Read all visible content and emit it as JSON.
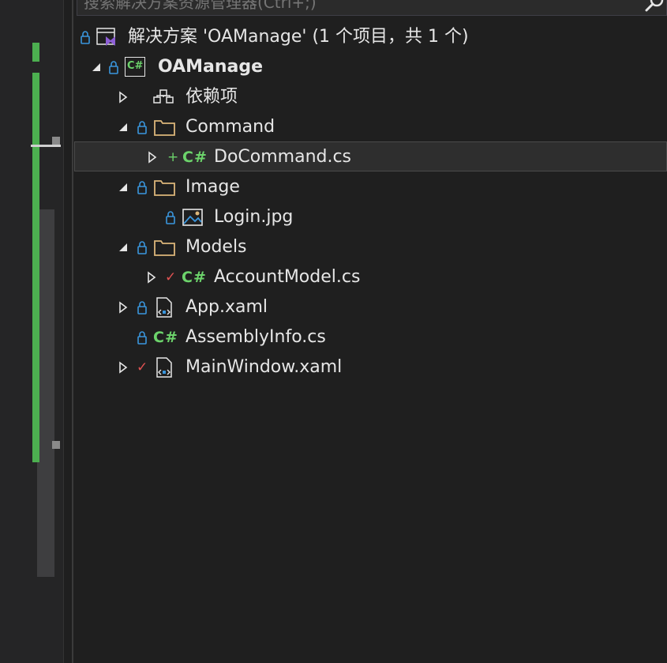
{
  "search": {
    "placeholder": "搜索解决方案资源管理器(Ctrl+;)"
  },
  "solution": {
    "label": "解决方案 'OAManage' (1 个项目，共 1 个)"
  },
  "project": {
    "label": "OAManage"
  },
  "tree": {
    "dependencies": "依赖项",
    "command": "Command",
    "docommand": "DoCommand.cs",
    "image": "Image",
    "login": "Login.jpg",
    "models": "Models",
    "accountmodel": "AccountModel.cs",
    "app": "App.xaml",
    "assemblyinfo": "AssemblyInfo.cs",
    "mainwindow": "MainWindow.xaml"
  },
  "glyphs": {
    "csharp": "C#",
    "added": "+",
    "checked": "✓"
  },
  "colors": {
    "background": "#1f1f1f",
    "lock": "#3a96dd",
    "csharp": "#6cd36b",
    "folder": "#dcb67a",
    "checked": "#e05252",
    "added": "#6cd36b",
    "gutter_green": "#4caf50",
    "vs_purple": "#8e5fd6"
  }
}
